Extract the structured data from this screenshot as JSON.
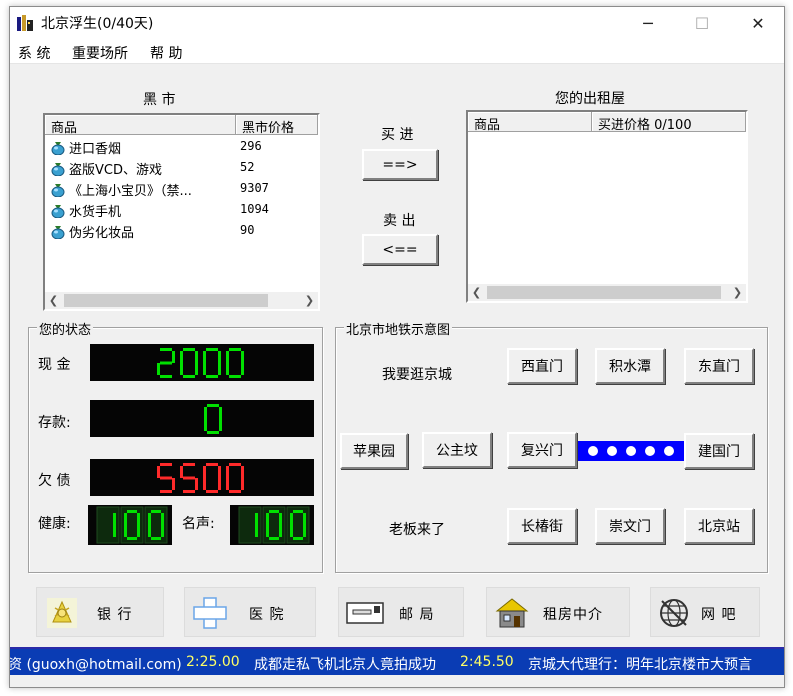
{
  "window": {
    "title": "北京浮生(0/40天)",
    "caption_buttons": {
      "minimize": "─",
      "maximize": "☐",
      "close": "✕"
    }
  },
  "menu": [
    "系 统",
    "重要场所",
    "帮 助"
  ],
  "black_market": {
    "title": "黑 市",
    "columns": [
      "商品",
      "黑市价格"
    ],
    "items": [
      {
        "name": "进口香烟",
        "price": "296"
      },
      {
        "name": "盗版VCD、游戏",
        "price": "52"
      },
      {
        "name": "《上海小宝贝》（禁...",
        "price": "9307"
      },
      {
        "name": "水货手机",
        "price": "1094"
      },
      {
        "name": "伪劣化妆品",
        "price": "90"
      }
    ]
  },
  "trade": {
    "buy_label": "买 进",
    "buy_button": "==>",
    "sell_label": "卖 出",
    "sell_button": "<=="
  },
  "rental": {
    "title": "您的出租屋",
    "columns": [
      "商品",
      "买进价格 0/100"
    ]
  },
  "status": {
    "title": "您的状态",
    "cash_label": "现 金",
    "cash_value": "2000",
    "deposit_label": "存款:",
    "deposit_value": "0",
    "debt_label": "欠 债",
    "debt_value": "5500",
    "health_label": "健康:",
    "health_value": "100",
    "fame_label": "名声:",
    "fame_value": "100",
    "colors": {
      "cash": "#00e000",
      "deposit": "#00e000",
      "debt": "#ff2a2a",
      "health": "#00e000",
      "fame": "#00e000"
    }
  },
  "subway": {
    "title": "北京市地铁示意图",
    "wander_label": "我要逛京城",
    "boss_label": "老板来了",
    "stations": {
      "xizhimen": "西直门",
      "jishuitan": "积水潭",
      "dongzhimen": "东直门",
      "pingguoyuan": "苹果园",
      "gongzhufen": "公主坟",
      "fuxingmen": "复兴门",
      "jianguomen": "建国门",
      "changchunjie": "长椿街",
      "chongwenmen": "崇文门",
      "beijingzhan": "北京站"
    },
    "line_color": "#0000ff"
  },
  "places": [
    {
      "label": "银  行",
      "icon": "bank-icon"
    },
    {
      "label": "医  院",
      "icon": "hospital-icon"
    },
    {
      "label": "邮  局",
      "icon": "post-office-icon"
    },
    {
      "label": "租房中介",
      "icon": "rental-agency-icon"
    },
    {
      "label": "网  吧",
      "icon": "internet-cafe-icon"
    }
  ],
  "ticker": {
    "t1": "资 (guoxh@hotmail.com)",
    "time1": "2:25.00",
    "t2": "成都走私飞机北京人竟拍成功",
    "time2": "2:45.50",
    "t3": "京城大代理行：明年北京楼市大预言"
  }
}
